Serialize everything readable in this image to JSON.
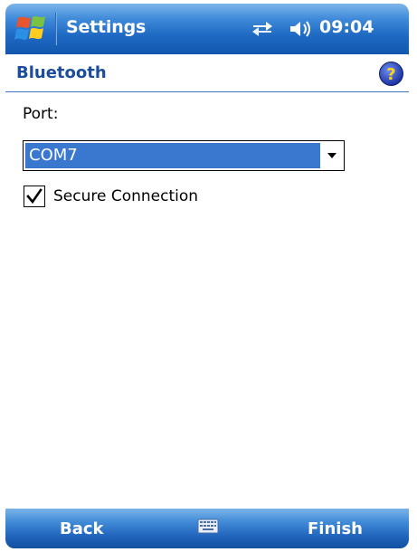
{
  "titlebar": {
    "app_title": "Settings",
    "clock": "09:04",
    "start_icon": "windows-flag-icon",
    "connectivity_icon": "connectivity-icon",
    "volume_icon": "speaker-icon"
  },
  "page": {
    "title": "Bluetooth",
    "help_icon": "help-icon"
  },
  "form": {
    "port_label": "Port:",
    "port_value": "COM7",
    "secure_connection_label": "Secure Connection",
    "secure_connection_checked": true
  },
  "softkeys": {
    "left": "Back",
    "right": "Finish",
    "keyboard_icon": "keyboard-icon"
  },
  "colors": {
    "titlebar": "#1f6ac4",
    "page_title": "#1c4c9c",
    "selection": "#3a77cf",
    "softbar": "#2064bc"
  }
}
